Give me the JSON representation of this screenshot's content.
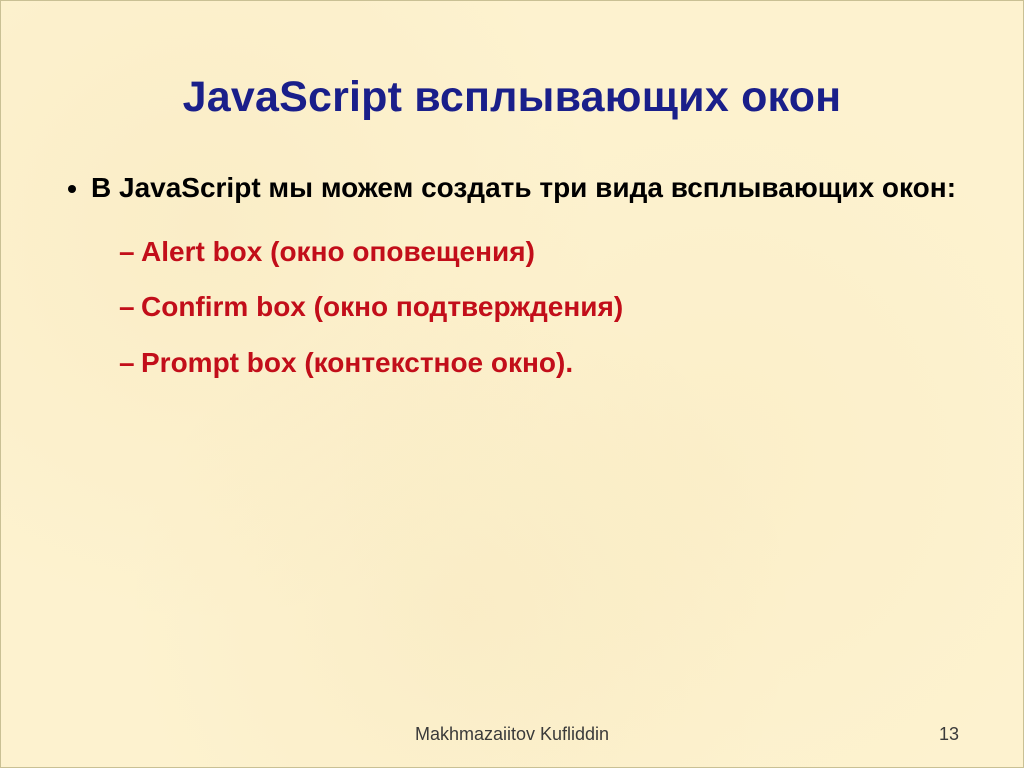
{
  "title": "JavaScript всплывающих окон",
  "body": {
    "lead": "В JavaScript мы можем создать три вида всплывающих окон:",
    "items": [
      "Alert box (окно оповещения)",
      "Confirm box (окно подтверждения)",
      "Prompt box (контекстное окно)."
    ]
  },
  "footer": {
    "author": "Makhmazaiitov Kufliddin",
    "page": "13"
  }
}
